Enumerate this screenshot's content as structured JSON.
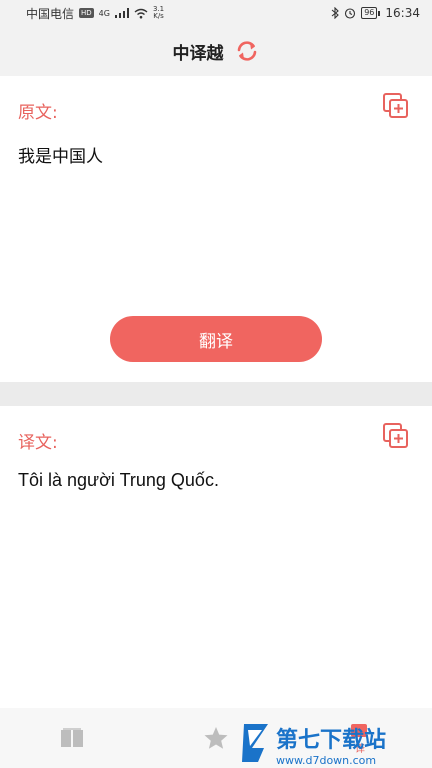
{
  "status_bar": {
    "carrier": "中国电信",
    "hd_badge": "HD",
    "signal_type": "4G",
    "net_speed_value": "3.1",
    "net_speed_unit": "K/s",
    "battery_level": "96",
    "time": "16:34"
  },
  "header": {
    "title": "中译越"
  },
  "source_panel": {
    "label": "原文:",
    "text": "我是中国人"
  },
  "translate_button": {
    "label": "翻译"
  },
  "target_panel": {
    "label": "译文:",
    "text": "Tôi là người Trung Quốc."
  },
  "bottom_nav": {
    "items": [
      {
        "icon": "book-icon"
      },
      {
        "icon": "star-icon"
      },
      {
        "icon": "translate-icon",
        "label": "译"
      }
    ]
  },
  "watermark": {
    "brand": "第七下载站",
    "url": "www.d7down.com"
  },
  "colors": {
    "accent": "#f06560",
    "label": "#e8635e",
    "background": "#ebebeb",
    "panel": "#ffffff"
  }
}
